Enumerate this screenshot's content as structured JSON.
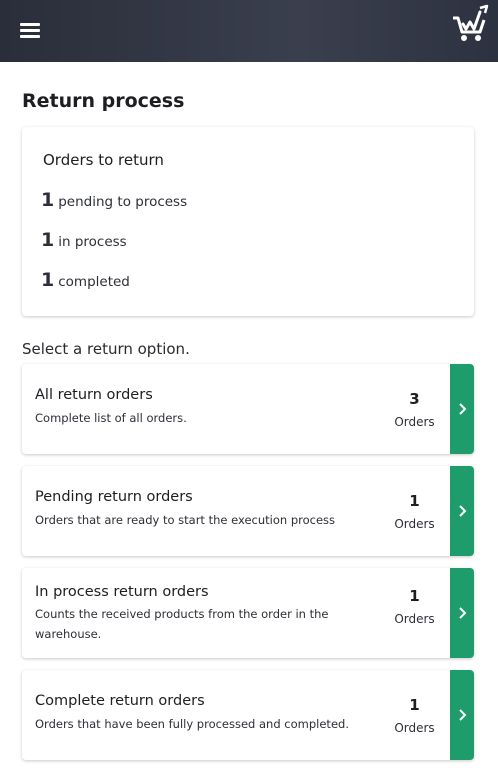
{
  "header": {
    "menu_icon": "hamburger-menu-icon",
    "logo_icon": "shopping-cart-logo-icon"
  },
  "page": {
    "title": "Return process"
  },
  "summary": {
    "title": "Orders to return",
    "stats": [
      {
        "count": "1",
        "label": "pending to process"
      },
      {
        "count": "1",
        "label": "in process"
      },
      {
        "count": "1",
        "label": "completed"
      }
    ]
  },
  "select_label": "Select a return option.",
  "options": [
    {
      "title": "All return orders",
      "description": "Complete list of all orders.",
      "count": "3",
      "unit": "Orders"
    },
    {
      "title": "Pending return orders",
      "description": "Orders that are ready to start the execution process",
      "count": "1",
      "unit": "Orders"
    },
    {
      "title": "In process return orders",
      "description": "Counts the received products from the order in the warehouse.",
      "count": "1",
      "unit": "Orders"
    },
    {
      "title": "Complete return orders",
      "description": "Orders that have been fully processed and completed.",
      "count": "1",
      "unit": "Orders"
    }
  ],
  "colors": {
    "accent": "#1e9c6c",
    "header": "#2f3441"
  }
}
